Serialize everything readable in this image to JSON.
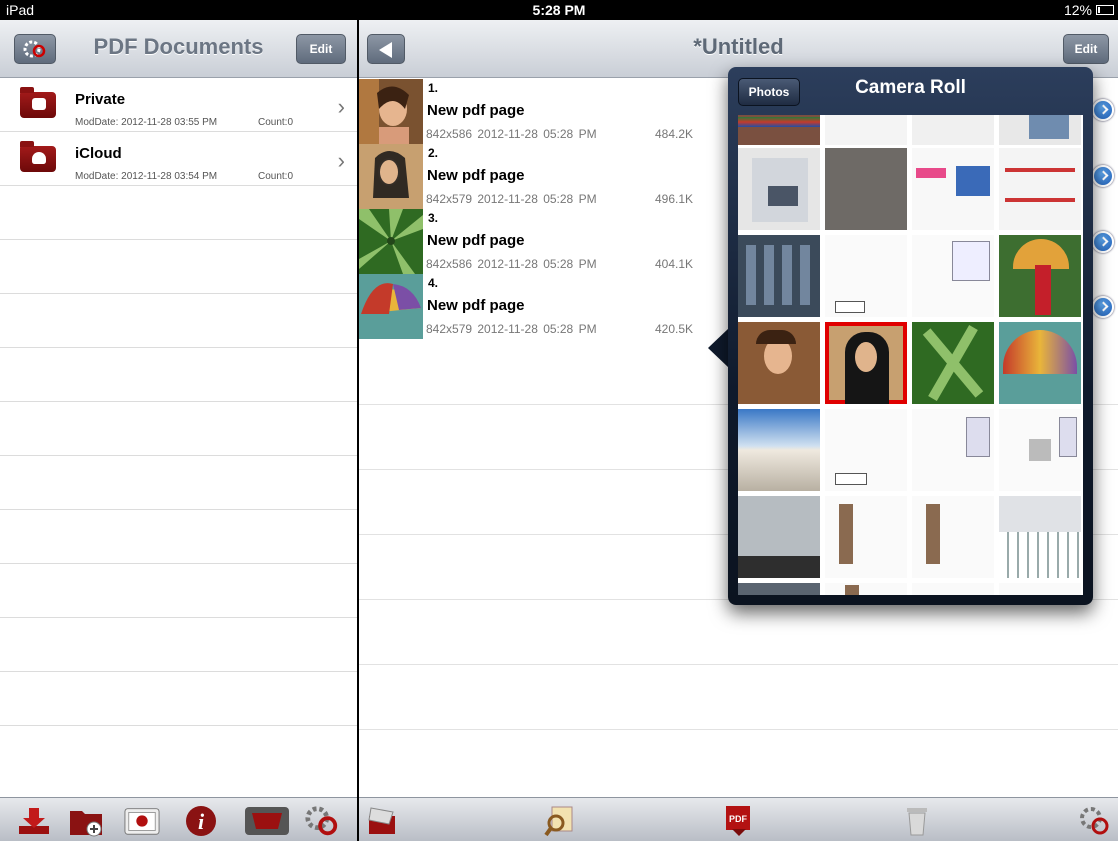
{
  "status_bar": {
    "carrier": "iPad",
    "time": "5:28 PM",
    "battery": "12%"
  },
  "left_pane": {
    "title": "PDF Documents",
    "edit_label": "Edit",
    "folders": [
      {
        "name": "Private",
        "moddate": "ModDate: 2012-11-28 03:55 PM",
        "count": "Count:0"
      },
      {
        "name": "iCloud",
        "moddate": "ModDate: 2012-11-28 03:54 PM",
        "count": "Count:0"
      }
    ]
  },
  "right_pane": {
    "title": "*Untitled",
    "edit_label": "Edit",
    "pages": [
      {
        "num": "1.",
        "name": "New pdf page",
        "meta": "842x586  2012-11-28 05:28 PM",
        "size": "484.2K"
      },
      {
        "num": "2.",
        "name": "New pdf page",
        "meta": "842x579  2012-11-28 05:28 PM",
        "size": "496.1K"
      },
      {
        "num": "3.",
        "name": "New pdf page",
        "meta": "842x586  2012-11-28 05:28 PM",
        "size": "404.1K"
      },
      {
        "num": "4.",
        "name": "New pdf page",
        "meta": "842x579  2012-11-28 05:28 PM",
        "size": "420.5K"
      }
    ]
  },
  "popover": {
    "title": "Camera Roll",
    "back_label": "Photos"
  },
  "colors": {
    "accent_blue": "#1f5cb4",
    "folder_red": "#8a1212",
    "selected_outline": "#e00000"
  }
}
